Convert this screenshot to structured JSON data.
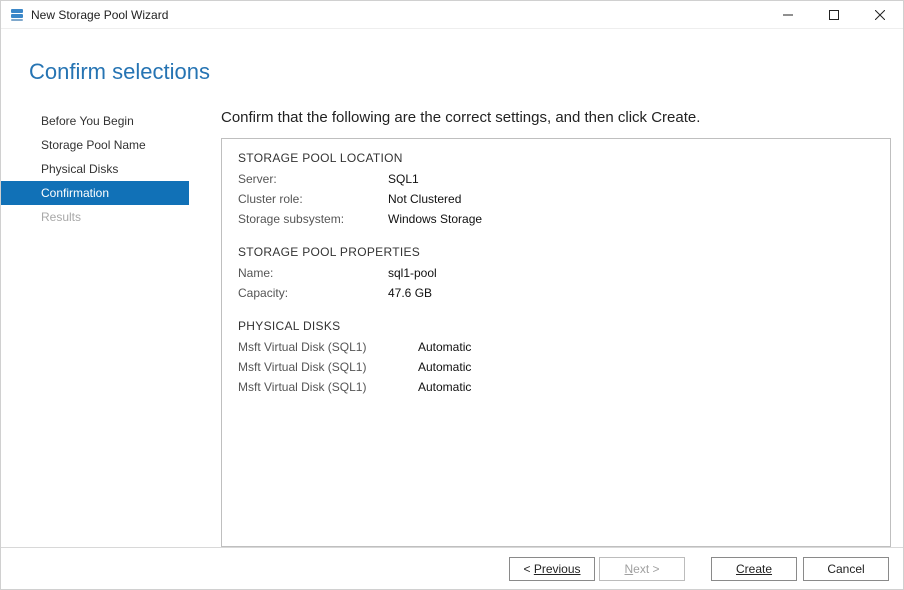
{
  "window": {
    "title": "New Storage Pool Wizard"
  },
  "header": {
    "title": "Confirm selections"
  },
  "sidebar": {
    "items": [
      {
        "label": "Before You Begin",
        "state": "normal"
      },
      {
        "label": "Storage Pool Name",
        "state": "normal"
      },
      {
        "label": "Physical Disks",
        "state": "normal"
      },
      {
        "label": "Confirmation",
        "state": "active"
      },
      {
        "label": "Results",
        "state": "disabled"
      }
    ]
  },
  "main": {
    "instruction": "Confirm that the following are the correct settings, and then click Create.",
    "sections": {
      "location": {
        "heading": "STORAGE POOL LOCATION",
        "server_label": "Server:",
        "server_value": "SQL1",
        "cluster_label": "Cluster role:",
        "cluster_value": "Not Clustered",
        "subsystem_label": "Storage subsystem:",
        "subsystem_value": "Windows Storage"
      },
      "properties": {
        "heading": "STORAGE POOL PROPERTIES",
        "name_label": "Name:",
        "name_value": "sql1-pool",
        "capacity_label": "Capacity:",
        "capacity_value": "47.6 GB"
      },
      "disks": {
        "heading": "PHYSICAL DISKS",
        "rows": [
          {
            "name": "Msft Virtual Disk (SQL1)",
            "mode": "Automatic"
          },
          {
            "name": "Msft Virtual Disk (SQL1)",
            "mode": "Automatic"
          },
          {
            "name": "Msft Virtual Disk (SQL1)",
            "mode": "Automatic"
          }
        ]
      }
    }
  },
  "footer": {
    "previous": "Previous",
    "next": "Next >",
    "create": "Create",
    "cancel": "Cancel"
  }
}
